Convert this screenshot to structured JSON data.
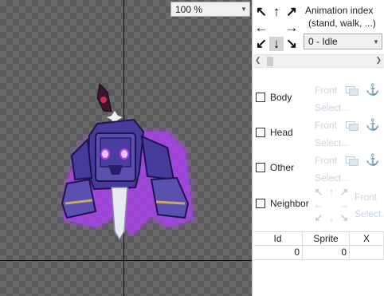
{
  "canvas": {
    "zoom": {
      "value": "100 %"
    }
  },
  "panel": {
    "animation": {
      "label": "Animation index",
      "sublabel": "(stand, walk, ...)",
      "selected": "0 - Idle"
    },
    "layers": [
      {
        "name": "Body",
        "front": "Front",
        "select": "Select..."
      },
      {
        "name": "Head",
        "front": "Front",
        "select": "Select..."
      },
      {
        "name": "Other",
        "front": "Front",
        "select": "Select..."
      },
      {
        "name": "Neighbor",
        "front": "Front",
        "select": "Select..."
      }
    ],
    "grid": {
      "columns": [
        "Id",
        "Sprite",
        "X"
      ],
      "rows": [
        [
          "0",
          "0",
          ""
        ]
      ]
    }
  },
  "colors": {
    "checker_dark": "#5a5a5a",
    "checker_light": "#6a6a6a",
    "golem_body": "#5b4fb0",
    "golem_glow": "#b33cff",
    "disabled_text": "#c8d4df"
  },
  "icons": {
    "direction_pad": [
      "arrow-nw-icon",
      "arrow-n-icon",
      "arrow-ne-icon",
      "arrow-w-icon",
      "arrow-e-icon",
      "arrow-sw-icon",
      "arrow-s-icon",
      "arrow-se-icon"
    ],
    "layer_icons": [
      "image-icon",
      "anchor-icon"
    ]
  }
}
